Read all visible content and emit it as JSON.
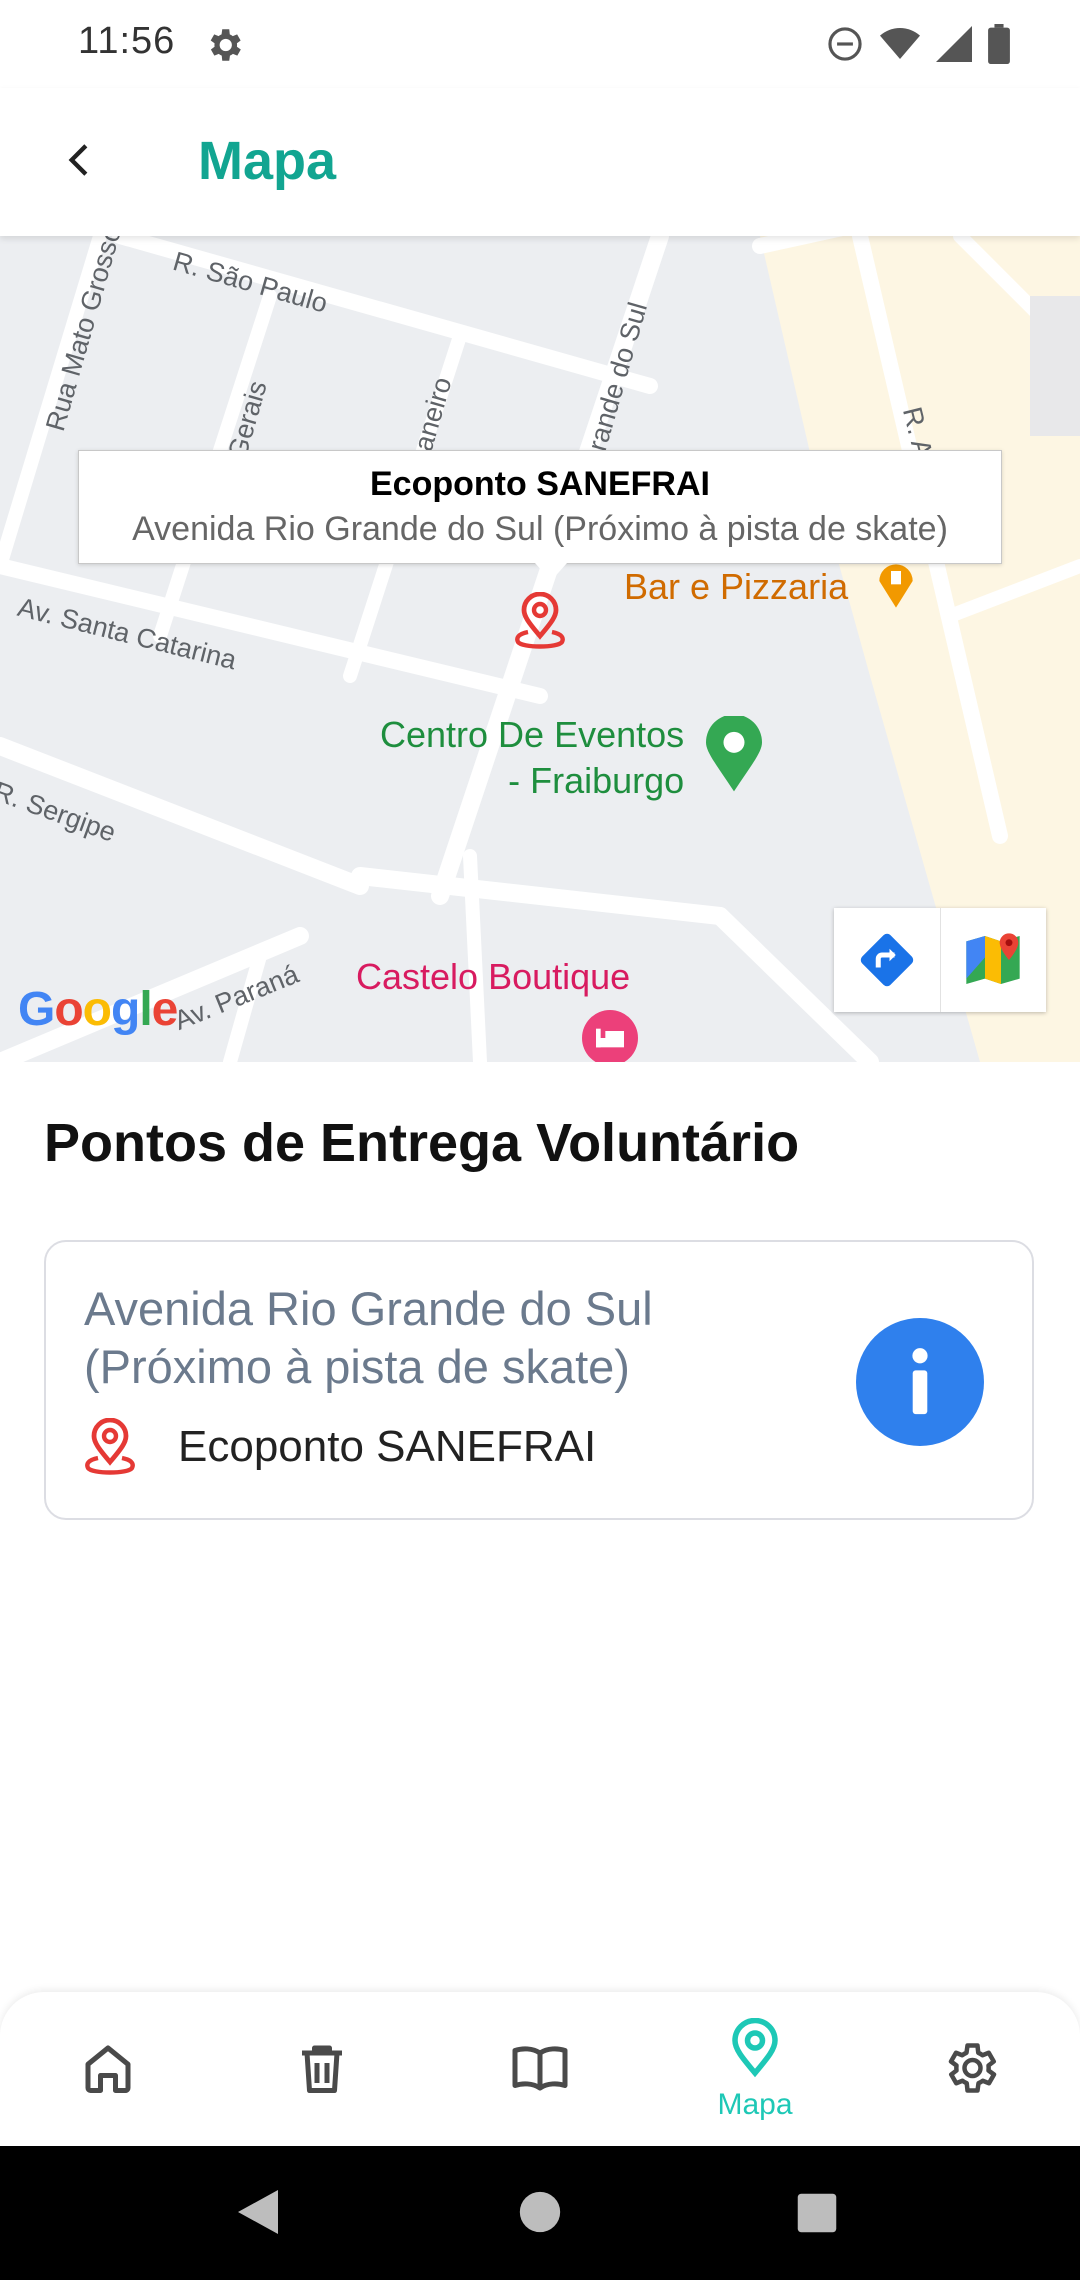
{
  "status_bar": {
    "time": "11:56"
  },
  "app_bar": {
    "title": "Mapa"
  },
  "map": {
    "streets": [
      "R. São Paulo",
      "Rua Mato Grosso",
      "Gerais",
      "aneiro",
      "rande do Sul",
      "Av. Santa Catarina",
      "R. Sergipe",
      "Av. Paraná",
      "R. Ar"
    ],
    "pois": {
      "bar": "Bar e Pizzaria",
      "event_line1": "Centro De Eventos",
      "event_line2": "- Fraiburgo",
      "hotel": "Castelo Boutique"
    },
    "info_window": {
      "title": "Ecoponto SANEFRAI",
      "subtitle": "Avenida Rio Grande do Sul (Próximo à pista de skate)"
    },
    "logo": "Google"
  },
  "section": {
    "title": "Pontos de Entrega Voluntário"
  },
  "points": [
    {
      "address": "Avenida Rio Grande do Sul (Próximo à pista de skate)",
      "name": "Ecoponto SANEFRAI"
    }
  ],
  "bottom_nav": {
    "active_label": "Mapa"
  },
  "colors": {
    "accent": "#12a591",
    "nav_active": "#1ec8b6",
    "marker": "#e53935",
    "info_button": "#2f80ed"
  }
}
